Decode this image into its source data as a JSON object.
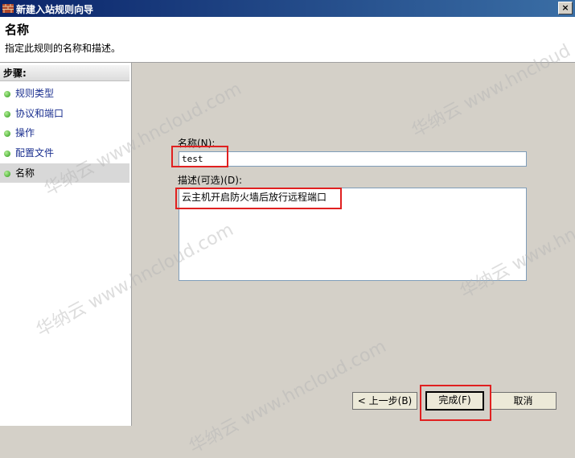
{
  "window": {
    "title": "新建入站规则向导",
    "close_glyph": "×"
  },
  "header": {
    "title": "名称",
    "description": "指定此规则的名称和描述。"
  },
  "sidebar": {
    "title": "步骤:",
    "items": [
      {
        "label": "规则类型"
      },
      {
        "label": "协议和端口"
      },
      {
        "label": "操作"
      },
      {
        "label": "配置文件"
      },
      {
        "label": "名称",
        "active": true
      }
    ]
  },
  "form": {
    "name_label": "名称(N):",
    "name_value": "test",
    "desc_label": "描述(可选)(D):",
    "desc_value": "云主机开启防火墙后放行远程端口"
  },
  "buttons": {
    "back": "< 上一步(B)",
    "finish": "完成(F)",
    "cancel": "取消"
  },
  "watermark": {
    "text_a": "华纳云 www.hncloud.com",
    "text_b": "华纳云 www.hncloud"
  },
  "colors": {
    "highlight": "#e02020",
    "title_bar": "#0a246a"
  }
}
